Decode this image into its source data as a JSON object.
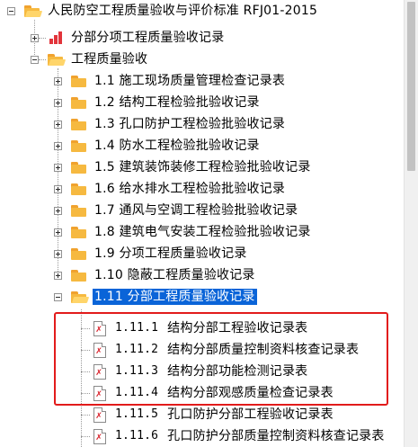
{
  "colors": {
    "selection": "#0a64d8",
    "folder": "#f6b940",
    "annotation_box": "#e21b1b",
    "doc_mark": "#d8202a"
  },
  "tree": {
    "root": {
      "label": "人民防空工程质量验收与评价标准 RFJ01-2015",
      "icon": "folder-open-icon",
      "state": "expanded"
    },
    "section_records": {
      "label": "分部分项工程质量验收记录",
      "icon": "bar-chart-icon",
      "state": "collapsed"
    },
    "section_acceptance": {
      "label": "工程质量验收",
      "icon": "folder-open-icon",
      "state": "expanded"
    },
    "folders": [
      {
        "label": "1.1  施工现场质量管理检查记录表"
      },
      {
        "label": "1.2  结构工程检验批验收记录"
      },
      {
        "label": "1.3  孔口防护工程检验批验收记录"
      },
      {
        "label": "1.4  防水工程检验批验收记录"
      },
      {
        "label": "1.5  建筑装饰装修工程检验批验收记录"
      },
      {
        "label": "1.6  给水排水工程检验批验收记录"
      },
      {
        "label": "1.7  通风与空调工程检验批验收记录"
      },
      {
        "label": "1.8  建筑电气安装工程检验批验收记录"
      },
      {
        "label": "1.9  分项工程质量验收记录"
      },
      {
        "label": "1.10  隐蔽工程质量验收记录"
      },
      {
        "label": "1.11  分部工程质量验收记录",
        "selected": true,
        "state": "expanded"
      }
    ],
    "documents": [
      {
        "number": "1.11.1",
        "title": "结构分部工程验收记录表"
      },
      {
        "number": "1.11.2",
        "title": "结构分部质量控制资料核查记录表"
      },
      {
        "number": "1.11.3",
        "title": "结构分部功能检测记录表"
      },
      {
        "number": "1.11.4",
        "title": "结构分部观感质量检查记录表"
      },
      {
        "number": "1.11.5",
        "title": "孔口防护分部工程验收记录表"
      },
      {
        "number": "1.11.6",
        "title": "孔口防护分部质量控制资料核查记录表"
      }
    ]
  }
}
